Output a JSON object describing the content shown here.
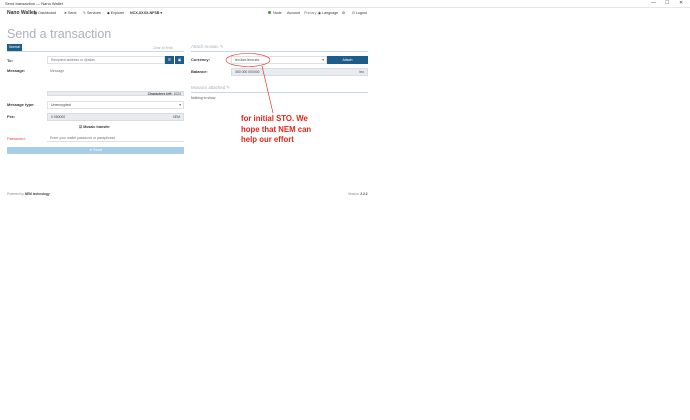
{
  "window": {
    "title": "Send transaction — Nano Wallet",
    "controls": [
      "—",
      "☐",
      "✕"
    ]
  },
  "nav": {
    "brand": "Nano Wallet",
    "items": [
      "Dashboard",
      "Send",
      "Services",
      "Explorer"
    ],
    "account_selector": "NCX-XXXX-NFSB ▾",
    "node_status": "Node",
    "account_label": "Account",
    "account_value": "Primary",
    "language": "Language",
    "logout": "Logout"
  },
  "page": {
    "title": "Send a transaction",
    "tab_normal": "Normal",
    "clear_link": "Clear all fields",
    "to_label": "To:",
    "to_placeholder": "Recipient address or @alias",
    "message_label": "Message:",
    "message_placeholder": "Message",
    "characters_left_label": "Characters left:",
    "characters_left_value": "1024",
    "message_type_label": "Message type:",
    "message_type_value": "Unencrypted",
    "fee_label": "Fee:",
    "fee_value": "0.050000",
    "fee_unit": "XEM",
    "mosaic_transfer": "Mosaic transfer",
    "password_label": "Password:",
    "password_placeholder": "Enter your wallet password or passphrase",
    "send_button": "Send"
  },
  "mosaic": {
    "section_title": "Attach mosaic",
    "currency_label": "Currency:",
    "currency_value": "leo.lion:leon.sto",
    "attach_button": "Attach",
    "balance_label": "Balance:",
    "balance_value": "350 000 000000",
    "balance_unit": "leo",
    "attached_title": "Mosaics attached",
    "attached_empty": "Nothing to show"
  },
  "annotation": {
    "lines": [
      "for initial STO. We",
      "hope that NEM can",
      "help our effort"
    ],
    "color": "#e3261b"
  },
  "footer": {
    "powered_by": "Powered by",
    "brand": "NEM technology",
    "version_label": "Version:",
    "version_value": "2.2.2"
  },
  "colors": {
    "primary": "#1e5c8a",
    "send_disabled": "#a8cde7",
    "title_grey": "#a9b1b9",
    "password_label": "#e14a4a"
  }
}
